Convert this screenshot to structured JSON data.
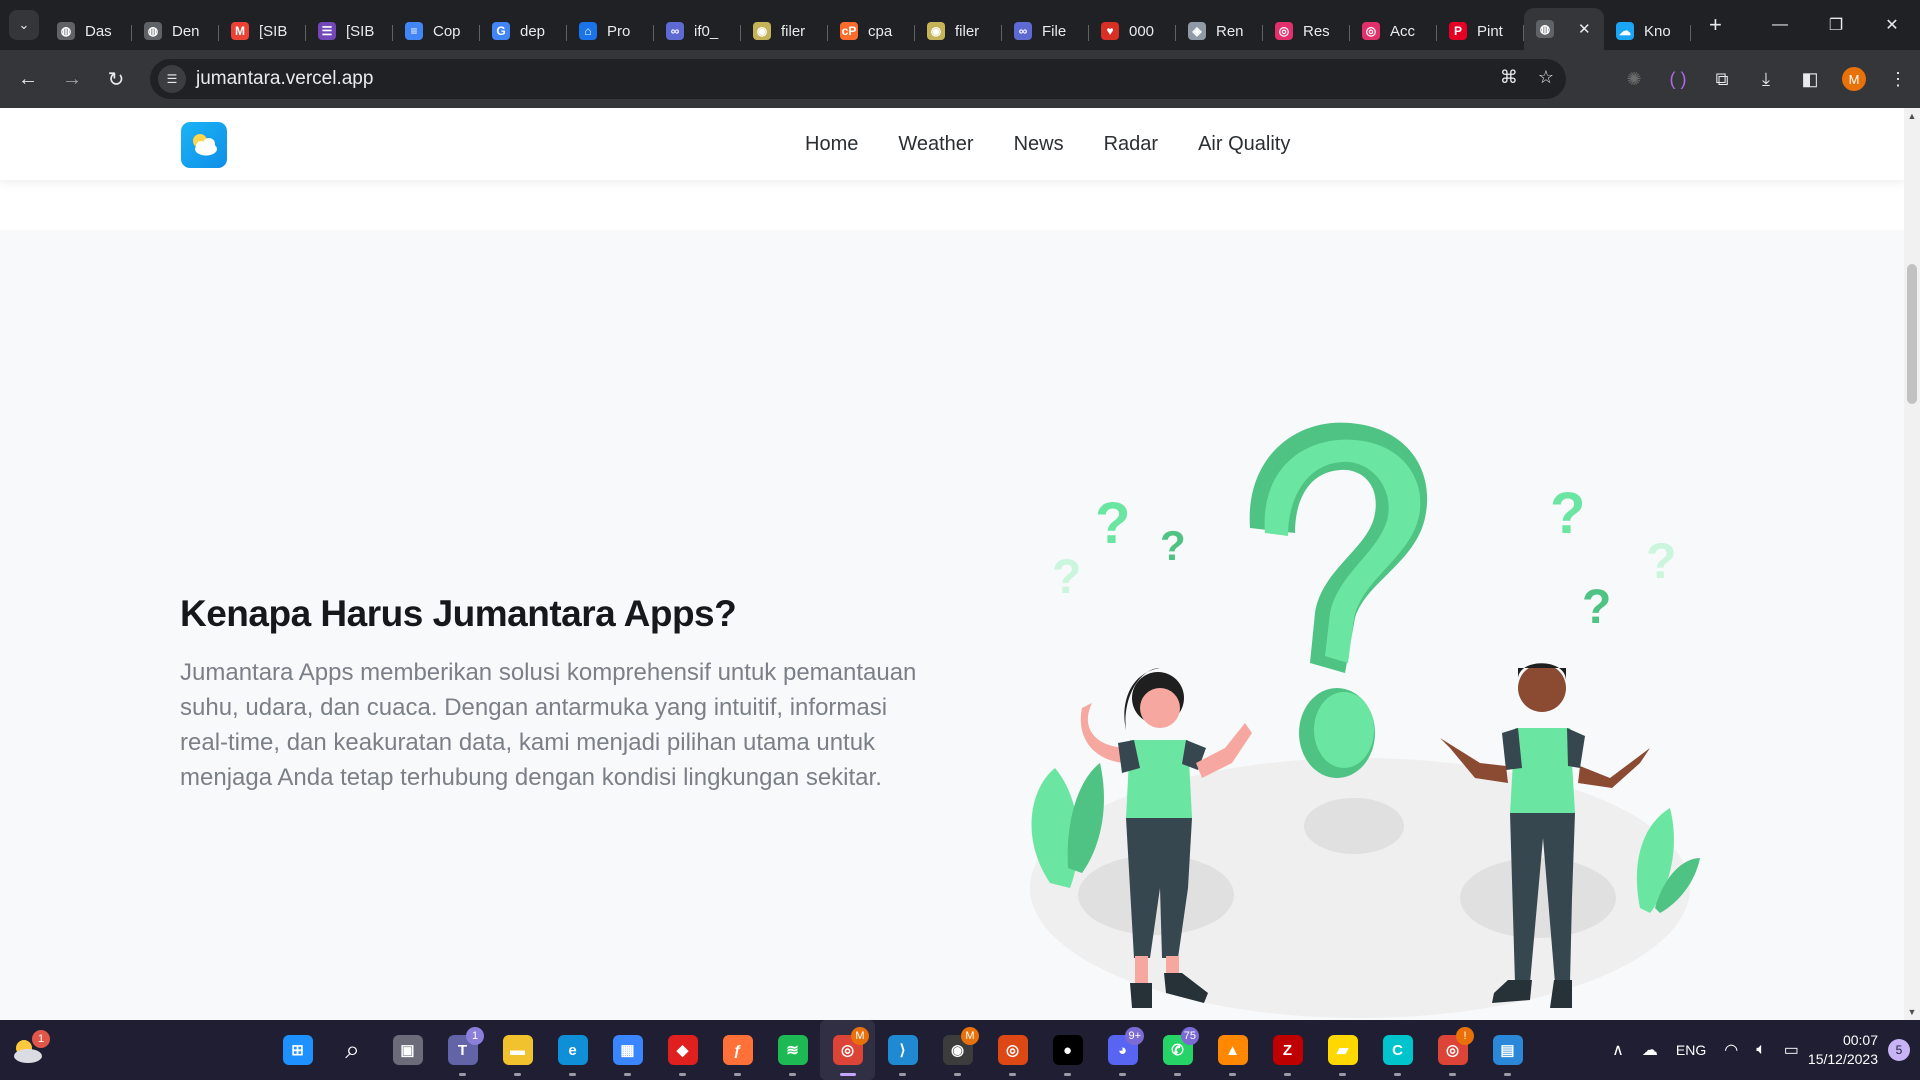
{
  "browser": {
    "tabs": [
      {
        "title": "Das",
        "icon": "globe-icon",
        "color": "#5f6368"
      },
      {
        "title": "Den",
        "icon": "globe-icon",
        "color": "#5f6368"
      },
      {
        "title": "[SIB",
        "icon": "gmail-icon",
        "color": "#ea4335"
      },
      {
        "title": "[SIB",
        "icon": "forms-icon",
        "color": "#7248b9"
      },
      {
        "title": "Cop",
        "icon": "docs-icon",
        "color": "#4285f4"
      },
      {
        "title": "dep",
        "icon": "google-icon",
        "color": "#4285f4"
      },
      {
        "title": "Pro",
        "icon": "home-icon",
        "color": "#1a73e8"
      },
      {
        "title": "if0_",
        "icon": "infinity-icon",
        "color": "#5e6ad2"
      },
      {
        "title": "filer",
        "icon": "shield-icon",
        "color": "#c5b358"
      },
      {
        "title": "cpa",
        "icon": "cpanel-icon",
        "color": "#ff6c2c"
      },
      {
        "title": "filer",
        "icon": "shield-icon",
        "color": "#c5b358"
      },
      {
        "title": "File",
        "icon": "infinity-icon",
        "color": "#5e6ad2"
      },
      {
        "title": "000",
        "icon": "heart-icon",
        "color": "#d93025"
      },
      {
        "title": "Ren",
        "icon": "layers-icon",
        "color": "#8f9aa6"
      },
      {
        "title": "Res",
        "icon": "instagram-icon",
        "color": "#e1306c"
      },
      {
        "title": "Acc",
        "icon": "instagram-icon",
        "color": "#e1306c"
      },
      {
        "title": "Pint",
        "icon": "pinterest-icon",
        "color": "#e60023"
      },
      {
        "title": "",
        "icon": "globe-icon",
        "color": "#5f6368",
        "active": true
      },
      {
        "title": "Kno",
        "icon": "cloud-icon",
        "color": "#1ba5f5"
      }
    ],
    "url": "jumantara.vercel.app",
    "profile_initial": "M"
  },
  "site": {
    "nav": [
      "Home",
      "Weather",
      "News",
      "Radar",
      "Air Quality"
    ],
    "hero": {
      "title": "Kenapa Harus Jumantara Apps?",
      "text": "Jumantara Apps memberikan solusi komprehensif untuk pemantauan suhu, udara, dan cuaca. Dengan antarmuka yang intuitif, informasi real-time, dan keakuratan data, kami menjadi pilihan utama untuk menjaga Anda tetap terhubung dengan kondisi lingkungan sekitar."
    },
    "colors": {
      "accent": "#6be6a2",
      "accent_dark": "#4fc384",
      "logo": "#1aa6f2"
    }
  },
  "taskbar": {
    "weather_badge": "1",
    "apps": [
      {
        "name": "start",
        "glyph": "⊞",
        "color": "#1e90ff"
      },
      {
        "name": "search",
        "glyph": "⌕",
        "color": "transparent"
      },
      {
        "name": "task-view",
        "glyph": "▣",
        "color": "#6b6b7a"
      },
      {
        "name": "teams",
        "glyph": "T",
        "color": "#6264a7",
        "badge": "1"
      },
      {
        "name": "file-explorer",
        "glyph": "▬",
        "color": "#f2c22e"
      },
      {
        "name": "edge",
        "glyph": "e",
        "color": "#0f8fd8"
      },
      {
        "name": "store",
        "glyph": "▦",
        "color": "#3a86ff"
      },
      {
        "name": "app-red",
        "glyph": "◆",
        "color": "#e0201e"
      },
      {
        "name": "firefox",
        "glyph": "ƒ",
        "color": "#ff7139"
      },
      {
        "name": "spotify",
        "glyph": "≋",
        "color": "#1db954"
      },
      {
        "name": "chrome",
        "glyph": "◎",
        "color": "#db4437",
        "badge": "M",
        "active": true
      },
      {
        "name": "vscode",
        "glyph": "⟩",
        "color": "#1f8ad2"
      },
      {
        "name": "app-radar",
        "glyph": "◉",
        "color": "#3c3c3c",
        "badge": "M"
      },
      {
        "name": "app-ubuntu",
        "glyph": "◎",
        "color": "#dd4814"
      },
      {
        "name": "github",
        "glyph": "●",
        "color": "#000000"
      },
      {
        "name": "discord",
        "glyph": "◕",
        "color": "#5865f2",
        "badge": "9+"
      },
      {
        "name": "whatsapp",
        "glyph": "✆",
        "color": "#25d366",
        "badge": "75"
      },
      {
        "name": "vlc",
        "glyph": "▲",
        "color": "#ff8800"
      },
      {
        "name": "filezilla",
        "glyph": "Z",
        "color": "#bf0000"
      },
      {
        "name": "sticky-notes",
        "glyph": "▰",
        "color": "#ffd800"
      },
      {
        "name": "canva",
        "glyph": "C",
        "color": "#00c4cc"
      },
      {
        "name": "chrome-2",
        "glyph": "◎",
        "color": "#db4437",
        "badge": "!"
      },
      {
        "name": "app-photo",
        "glyph": "▤",
        "color": "#2b88d8"
      }
    ],
    "tray": {
      "lang": "ENG",
      "time": "00:07",
      "date": "15/12/2023",
      "notifications": "5"
    }
  }
}
